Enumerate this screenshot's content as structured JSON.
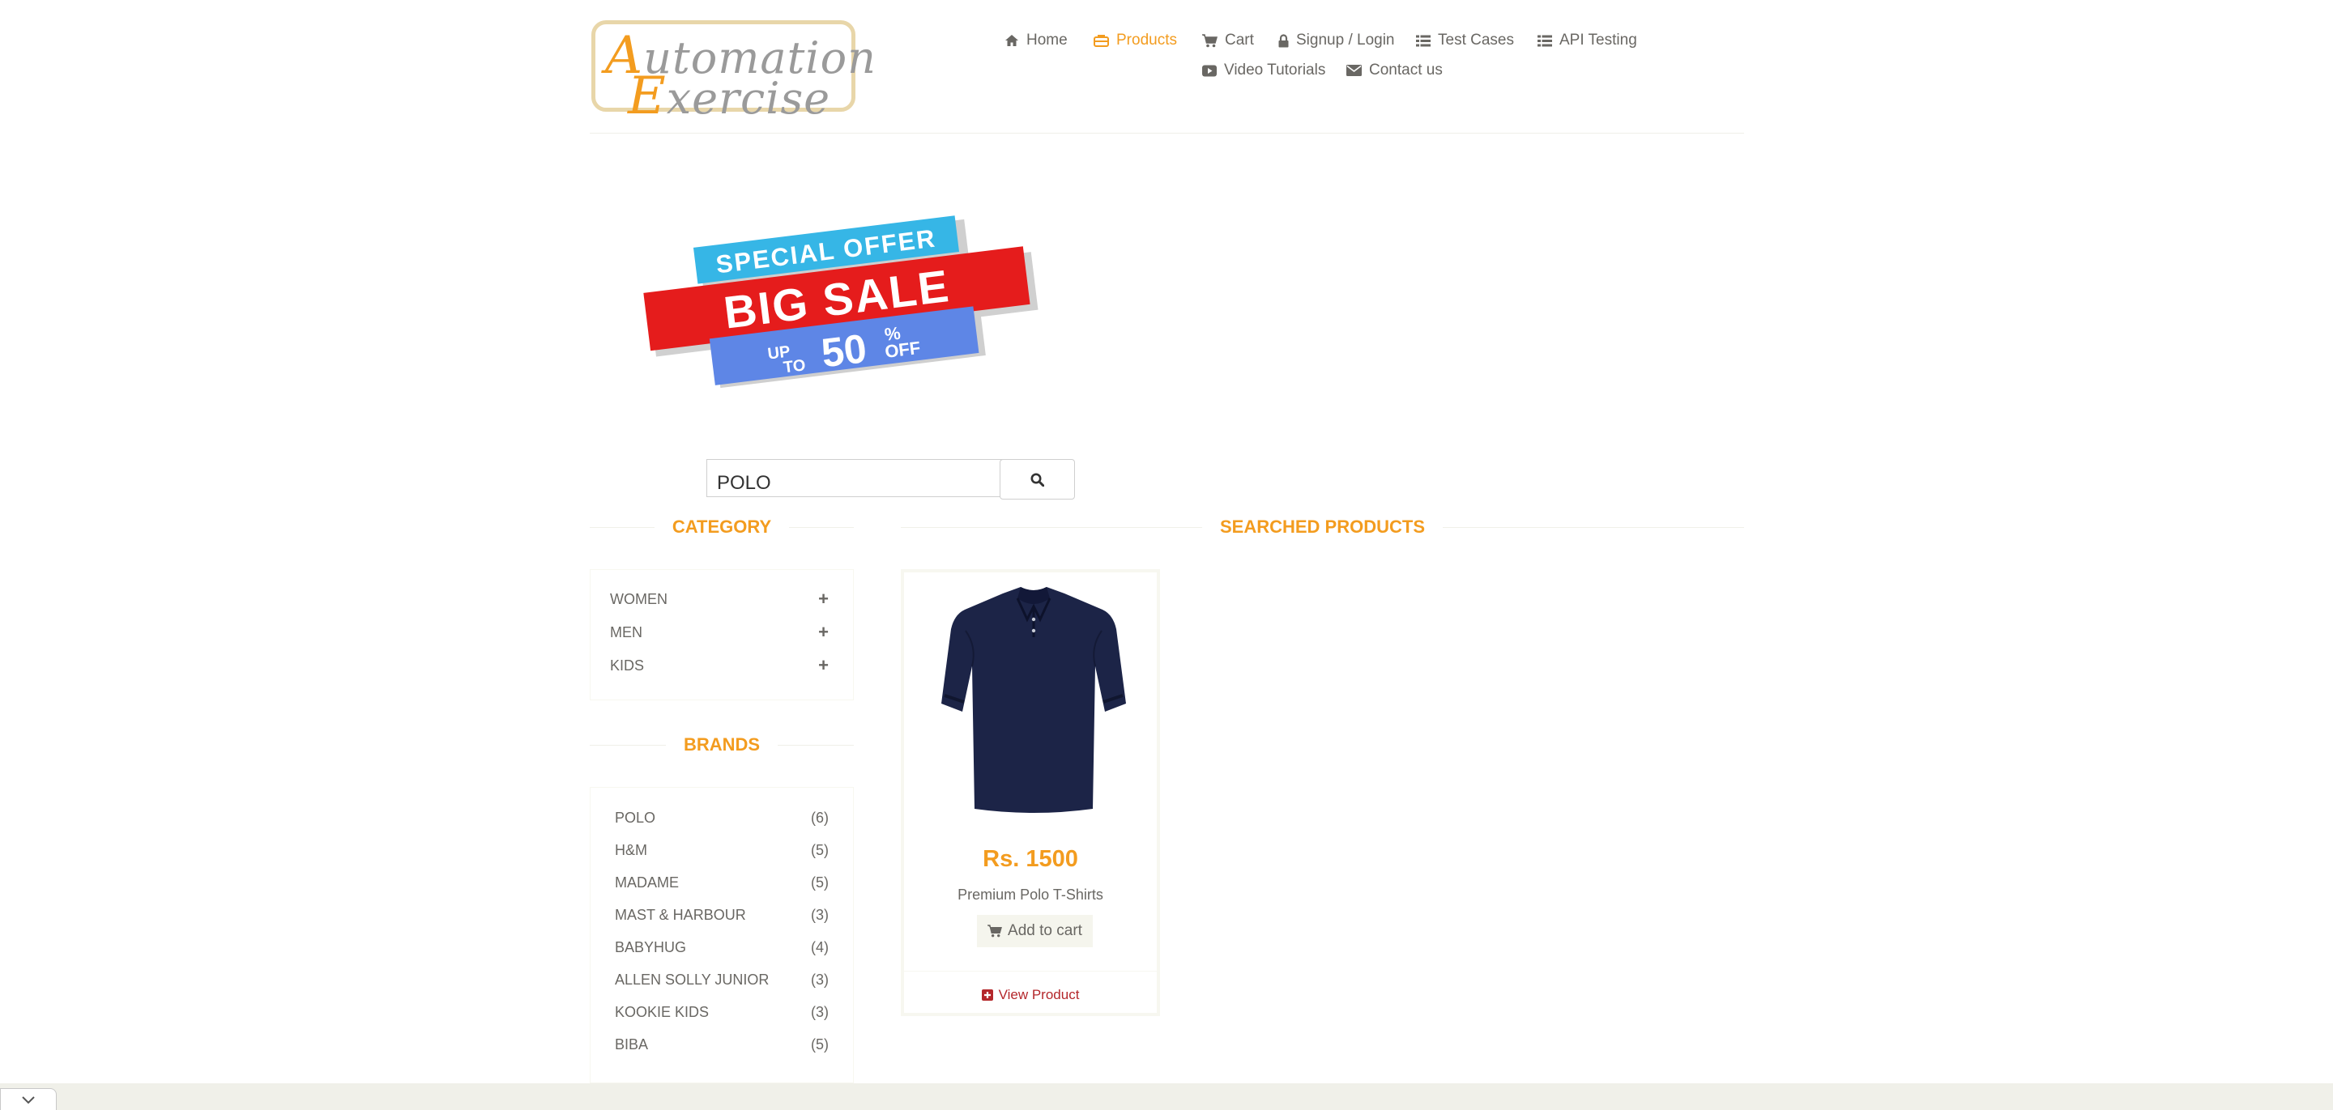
{
  "logo": {
    "line1_big": "A",
    "line1_rest": "utomation",
    "line2_big": "E",
    "line2_rest": "xercise"
  },
  "nav": {
    "items": [
      {
        "label": "Home",
        "icon": "home-icon",
        "active": false
      },
      {
        "label": "Products",
        "icon": "shopping-bag-icon",
        "active": true
      },
      {
        "label": "Cart",
        "icon": "cart-icon",
        "active": false
      },
      {
        "label": "Signup / Login",
        "icon": "lock-icon",
        "active": false
      },
      {
        "label": "Test Cases",
        "icon": "list-icon",
        "active": false
      },
      {
        "label": "API Testing",
        "icon": "list-icon",
        "active": false
      },
      {
        "label": "Video Tutorials",
        "icon": "youtube-play-icon",
        "active": false
      },
      {
        "label": "Contact us",
        "icon": "envelope-icon",
        "active": false
      }
    ]
  },
  "banner": {
    "top": "SPECIAL OFFER",
    "middle": "BIG SALE",
    "up": "UP",
    "to": "TO",
    "percent_value": "50",
    "percent_sign": "%",
    "off": "OFF"
  },
  "search": {
    "value": "POLO"
  },
  "sidebar": {
    "category_title": "CATEGORY",
    "categories": [
      {
        "label": "WOMEN"
      },
      {
        "label": "MEN"
      },
      {
        "label": "KIDS"
      }
    ],
    "brands_title": "BRANDS",
    "brands": [
      {
        "name": "POLO",
        "count": "(6)"
      },
      {
        "name": "H&M",
        "count": "(5)"
      },
      {
        "name": "MADAME",
        "count": "(5)"
      },
      {
        "name": "MAST & HARBOUR",
        "count": "(3)"
      },
      {
        "name": "BABYHUG",
        "count": "(4)"
      },
      {
        "name": "ALLEN SOLLY JUNIOR",
        "count": "(3)"
      },
      {
        "name": "KOOKIE KIDS",
        "count": "(3)"
      },
      {
        "name": "BIBA",
        "count": "(5)"
      }
    ]
  },
  "main": {
    "title": "SEARCHED PRODUCTS",
    "products": [
      {
        "price": "Rs. 1500",
        "name": "Premium Polo T-Shirts",
        "add_to_cart": "Add to cart",
        "view_product": "View Product"
      }
    ]
  },
  "colors": {
    "accent": "#f39c1f",
    "text": "#696763",
    "view_product": "#b4272b"
  }
}
